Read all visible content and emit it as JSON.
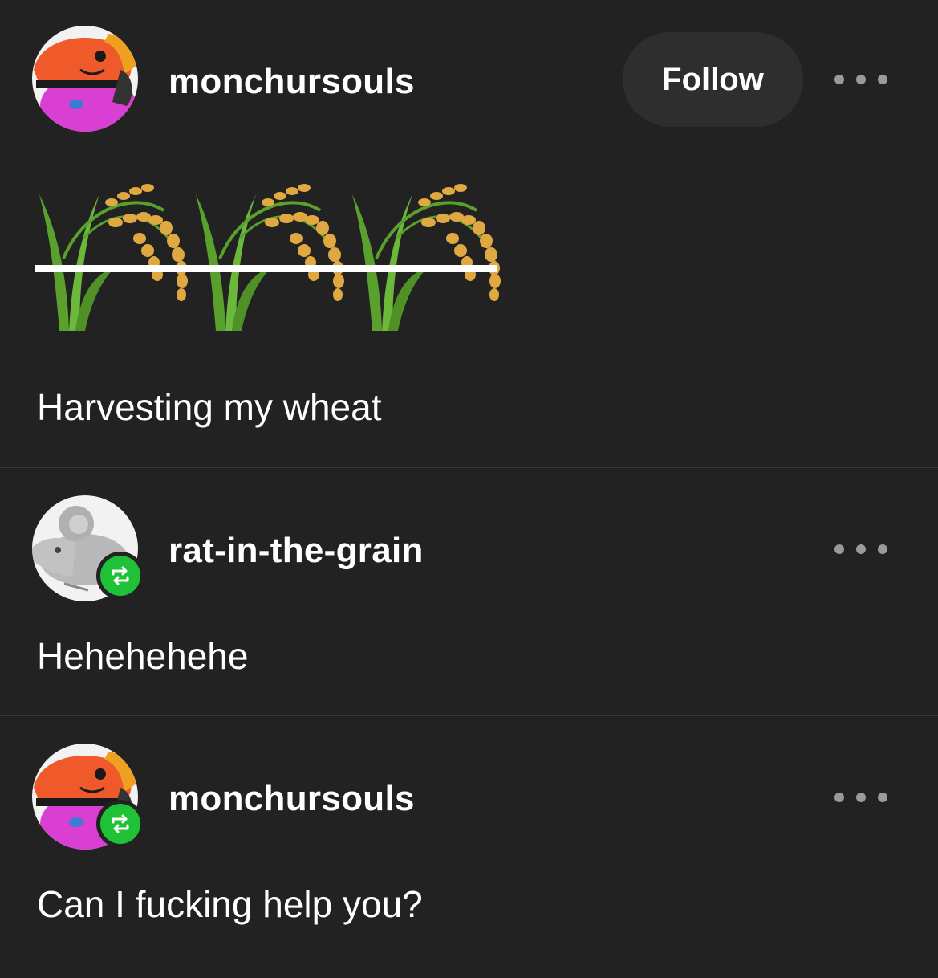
{
  "posts": [
    {
      "username": "monchursouls",
      "avatar_icon": "isopod-character-avatar",
      "follow_label": "Follow",
      "content_emoji": "rice-stalk-emoji-row",
      "text": "Harvesting my wheat"
    },
    {
      "username": "rat-in-the-grain",
      "avatar_icon": "mouse-avatar",
      "reblog_icon": "reblog-icon",
      "text": "Hehehehehe"
    },
    {
      "username": "monchursouls",
      "avatar_icon": "isopod-character-avatar",
      "reblog_icon": "reblog-icon",
      "text": "Can I fucking help you?"
    }
  ],
  "colors": {
    "background": "#222222",
    "divider": "#3a3a3a",
    "reblog_green": "#1fc236",
    "follow_bg": "#2e2e2e"
  }
}
